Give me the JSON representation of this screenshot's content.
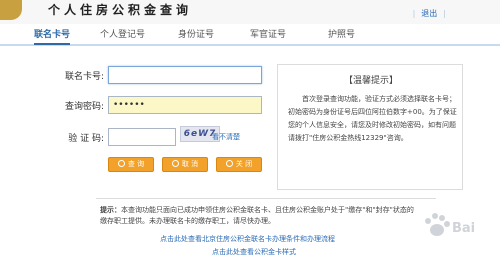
{
  "header": {
    "title": "个人住房公积金查询",
    "logout_label": "退出",
    "logo_icon": "emblem-icon"
  },
  "tabs": [
    {
      "label": "联名卡号",
      "active": true
    },
    {
      "label": "个人登记号",
      "active": false
    },
    {
      "label": "身份证号",
      "active": false
    },
    {
      "label": "军官证号",
      "active": false
    },
    {
      "label": "护照号",
      "active": false
    }
  ],
  "form": {
    "card_label": "联名卡号:",
    "card_value": "",
    "password_label": "查询密码:",
    "password_value": "••••••",
    "captcha_label": "验 证 码:",
    "captcha_value": "",
    "captcha_image_text": "6eW7",
    "refresh_link": "看不清楚"
  },
  "buttons": {
    "query": "查 询",
    "cancel": "取 消",
    "close": "关 闭"
  },
  "tip": {
    "title": "【温馨提示】",
    "body": "首次登录查询功能，验证方式必须选择联名卡号；初始密码为身份证号后四位阿拉伯数字+00。为了保证您的个人信息安全，请您及时修改初始密码，如有问题请拨打\"住房公积金热线12329\"咨询。"
  },
  "footer": {
    "notice_prefix": "提示：",
    "notice_text": "本查询功能只面向已成功申领住房公积金联名卡、且住房公积金账户处于\"缴存\"和\"封存\"状态的缴存职工提供。未办理联名卡的缴存职工，请尽快办理。",
    "link1": "点击此处查看北京住房公积金联名卡办理条件和办理流程",
    "link2": "点击此处查看公积金卡样式"
  },
  "colors": {
    "accent": "#2e6aa8",
    "button": "#f2a12a",
    "password_bg": "#fbf7c6"
  }
}
